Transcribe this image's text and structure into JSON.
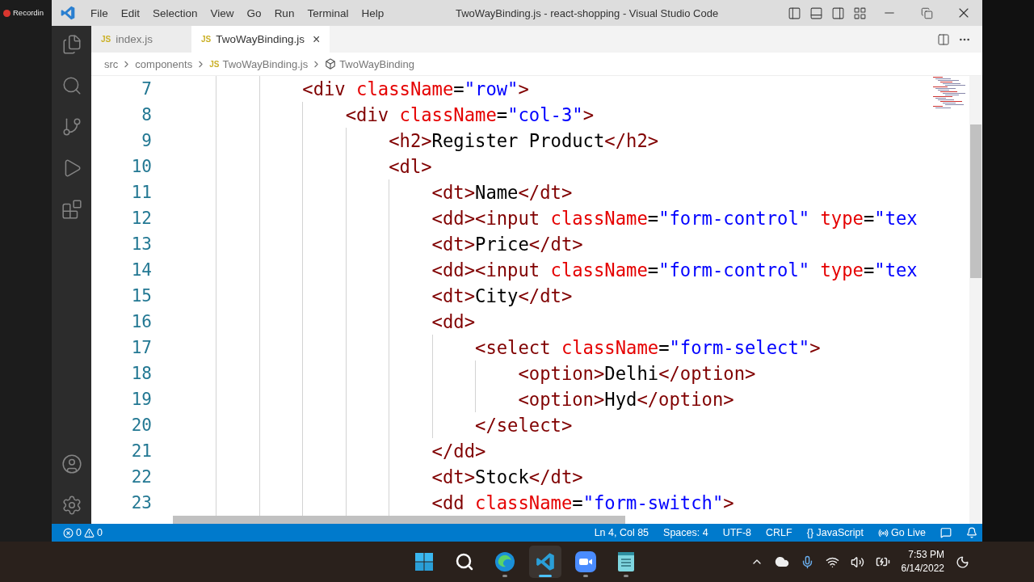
{
  "background_app": {
    "label": "Recordin"
  },
  "window": {
    "title": "TwoWayBinding.js - react-shopping - Visual Studio Code"
  },
  "menu": [
    "File",
    "Edit",
    "Selection",
    "View",
    "Go",
    "Run",
    "Terminal",
    "Help"
  ],
  "tabs": [
    {
      "label": "index.js",
      "badge": "JS",
      "selected": false
    },
    {
      "label": "TwoWayBinding.js",
      "badge": "JS",
      "selected": true,
      "close": "×"
    }
  ],
  "breadcrumb": [
    {
      "label": "src",
      "kind": "folder"
    },
    {
      "label": "components",
      "kind": "folder"
    },
    {
      "label": "TwoWayBinding.js",
      "kind": "file",
      "badge": "JS"
    },
    {
      "label": "TwoWayBinding",
      "kind": "symbol"
    }
  ],
  "editor": {
    "lines": [
      {
        "number": "7",
        "tokens": [
          {
            "kind": "tag",
            "text": "            <div "
          },
          {
            "kind": "attr",
            "text": "className"
          },
          {
            "kind": "plain",
            "text": "="
          },
          {
            "kind": "str",
            "text": "\"row\""
          },
          {
            "kind": "tag",
            "text": ">"
          }
        ]
      },
      {
        "number": "8",
        "tokens": [
          {
            "kind": "tag",
            "text": "                <div "
          },
          {
            "kind": "attr",
            "text": "className"
          },
          {
            "kind": "plain",
            "text": "="
          },
          {
            "kind": "str",
            "text": "\"col-3\""
          },
          {
            "kind": "tag",
            "text": ">"
          }
        ]
      },
      {
        "number": "9",
        "tokens": [
          {
            "kind": "tag",
            "text": "                    <h2>"
          },
          {
            "kind": "plain",
            "text": "Register Product"
          },
          {
            "kind": "tag",
            "text": "</h2>"
          }
        ]
      },
      {
        "number": "10",
        "tokens": [
          {
            "kind": "tag",
            "text": "                    <dl>"
          }
        ]
      },
      {
        "number": "11",
        "tokens": [
          {
            "kind": "tag",
            "text": "                        <dt>"
          },
          {
            "kind": "plain",
            "text": "Name"
          },
          {
            "kind": "tag",
            "text": "</dt>"
          }
        ]
      },
      {
        "number": "12",
        "tokens": [
          {
            "kind": "tag",
            "text": "                        <dd><input "
          },
          {
            "kind": "attr",
            "text": "className"
          },
          {
            "kind": "plain",
            "text": "="
          },
          {
            "kind": "str",
            "text": "\"form-control\" "
          },
          {
            "kind": "attr",
            "text": "type"
          },
          {
            "kind": "plain",
            "text": "="
          },
          {
            "kind": "str",
            "text": "\"tex"
          }
        ]
      },
      {
        "number": "13",
        "tokens": [
          {
            "kind": "tag",
            "text": "                        <dt>"
          },
          {
            "kind": "plain",
            "text": "Price"
          },
          {
            "kind": "tag",
            "text": "</dt>"
          }
        ]
      },
      {
        "number": "14",
        "tokens": [
          {
            "kind": "tag",
            "text": "                        <dd><input "
          },
          {
            "kind": "attr",
            "text": "className"
          },
          {
            "kind": "plain",
            "text": "="
          },
          {
            "kind": "str",
            "text": "\"form-control\" "
          },
          {
            "kind": "attr",
            "text": "type"
          },
          {
            "kind": "plain",
            "text": "="
          },
          {
            "kind": "str",
            "text": "\"tex"
          }
        ]
      },
      {
        "number": "15",
        "tokens": [
          {
            "kind": "tag",
            "text": "                        <dt>"
          },
          {
            "kind": "plain",
            "text": "City"
          },
          {
            "kind": "tag",
            "text": "</dt>"
          }
        ]
      },
      {
        "number": "16",
        "tokens": [
          {
            "kind": "tag",
            "text": "                        <dd>"
          }
        ]
      },
      {
        "number": "17",
        "tokens": [
          {
            "kind": "tag",
            "text": "                            <select "
          },
          {
            "kind": "attr",
            "text": "className"
          },
          {
            "kind": "plain",
            "text": "="
          },
          {
            "kind": "str",
            "text": "\"form-select\""
          },
          {
            "kind": "tag",
            "text": ">"
          }
        ]
      },
      {
        "number": "18",
        "tokens": [
          {
            "kind": "tag",
            "text": "                                <option>"
          },
          {
            "kind": "plain",
            "text": "Delhi"
          },
          {
            "kind": "tag",
            "text": "</option>"
          }
        ]
      },
      {
        "number": "19",
        "tokens": [
          {
            "kind": "tag",
            "text": "                                <option>"
          },
          {
            "kind": "plain",
            "text": "Hyd"
          },
          {
            "kind": "tag",
            "text": "</option>"
          }
        ]
      },
      {
        "number": "20",
        "tokens": [
          {
            "kind": "tag",
            "text": "                            </select>"
          }
        ]
      },
      {
        "number": "21",
        "tokens": [
          {
            "kind": "tag",
            "text": "                        </dd>"
          }
        ]
      },
      {
        "number": "22",
        "tokens": [
          {
            "kind": "tag",
            "text": "                        <dt>"
          },
          {
            "kind": "plain",
            "text": "Stock"
          },
          {
            "kind": "tag",
            "text": "</dt>"
          }
        ]
      },
      {
        "number": "23",
        "tokens": [
          {
            "kind": "tag",
            "text": "                        <dd "
          },
          {
            "kind": "attr",
            "text": "className"
          },
          {
            "kind": "plain",
            "text": "="
          },
          {
            "kind": "str",
            "text": "\"form-switch\""
          },
          {
            "kind": "tag",
            "text": ">"
          }
        ]
      }
    ]
  },
  "status_bar": {
    "errors": "0",
    "warnings": "0",
    "items": [
      {
        "label": "Ln 4, Col 85",
        "kind": "text"
      },
      {
        "label": "Spaces: 4",
        "kind": "text"
      },
      {
        "label": "UTF-8",
        "kind": "text"
      },
      {
        "label": "CRLF",
        "kind": "text"
      },
      {
        "label": "{} JavaScript",
        "kind": "text"
      },
      {
        "label": "Go Live",
        "kind": "live"
      }
    ]
  },
  "taskbar": {
    "apps": [
      {
        "kind": "start",
        "selected": false
      },
      {
        "kind": "search",
        "selected": false
      },
      {
        "kind": "browser",
        "selected": false
      },
      {
        "kind": "editor",
        "selected": true
      },
      {
        "kind": "video",
        "selected": false
      },
      {
        "kind": "notes",
        "selected": false
      }
    ],
    "time": "7:53 PM",
    "date": "6/14/2022"
  }
}
